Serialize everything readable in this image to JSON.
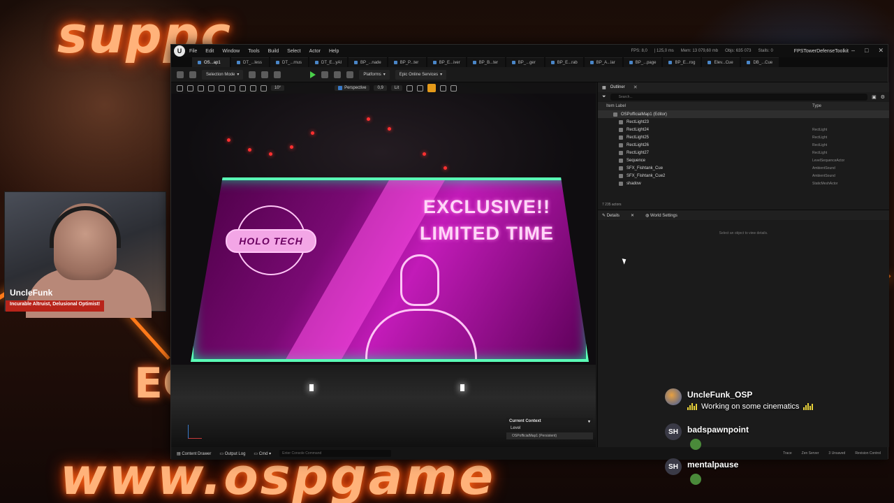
{
  "overlay": {
    "brand_top": "suppc",
    "brand_bottom": "www.ospgame",
    "side_letters": "EC",
    "streamer_name": "UncleFunk",
    "streamer_tagline": "Incurable Altruist, Delusional Optimist!"
  },
  "editor": {
    "menu": [
      "File",
      "Edit",
      "Window",
      "Tools",
      "Build",
      "Select",
      "Actor",
      "Help"
    ],
    "stats": [
      "FPS: 8,0",
      "| 125,0 ms",
      "Mem: 13 079,60 mb",
      "Objs: 635 073",
      "Stalls: 0"
    ],
    "project_title": "FPSTowerDefenseToolkit",
    "tabs": [
      "OS...ap1",
      "DT_...less",
      "DT_...rnus",
      "DT_E...yAI",
      "BP_...nade",
      "BP_P...ter",
      "BP_E...iver",
      "BP_B...ter",
      "BP_...ger",
      "BP_E...rab",
      "BP_A...lar",
      "BP_...page",
      "BP_E...rog",
      "Elev...Cue",
      "DB_...Cue"
    ],
    "toolbar": {
      "selection_mode": "Selection Mode",
      "platforms": "Platforms",
      "online_services": "Epic Online Services"
    },
    "viewport": {
      "perspective": "Perspective",
      "lit": "Lit",
      "speed": "0,9",
      "fov": "10°",
      "context_title": "Current Context",
      "context_level": "Level",
      "context_value": "OSPofficialMap1 (Persistent)"
    },
    "billboard": {
      "logo_text": "HOLO TECH",
      "line1": "EXCLUSIVE!!",
      "line2": "LIMITED TIME"
    },
    "outliner": {
      "tab_label": "Outliner",
      "search_placeholder": "Search...",
      "col_label": "Item Label",
      "col_type": "Type",
      "world_row": "OSPofficialMap1 (Editor)",
      "rows": [
        {
          "label": "RectLight23",
          "type": ""
        },
        {
          "label": "RectLight24",
          "type": "RectLight"
        },
        {
          "label": "RectLight25",
          "type": "RectLight"
        },
        {
          "label": "RectLight26",
          "type": "RectLight"
        },
        {
          "label": "RectLight27",
          "type": "RectLight"
        },
        {
          "label": "Sequence",
          "type": "LevelSequenceActor"
        },
        {
          "label": "SFX_Fishtank_Cue",
          "type": "AmbientSound"
        },
        {
          "label": "SFX_Fishtank_Cue2",
          "type": "AmbientSound"
        },
        {
          "label": "shadow",
          "type": "StaticMeshActor"
        }
      ],
      "actor_count": "7 235 actors"
    },
    "details": {
      "tab_details": "Details",
      "tab_world": "World Settings",
      "hint": "Select an object to view details."
    },
    "statusbar": {
      "content_drawer": "Content Drawer",
      "output_log": "Output Log",
      "cmd": "Cmd",
      "cmd_placeholder": "Enter Console Command",
      "trace": "Trace",
      "zen": "Zen Server",
      "unsaved": "3 Unsaved",
      "revision": "Revision Control"
    }
  },
  "chat": [
    {
      "avatar": "UF",
      "user": "UncleFunk_OSP",
      "text": "Working on some cinematics"
    },
    {
      "avatar": "SH",
      "user": "badspawnpoint",
      "text": ""
    },
    {
      "avatar": "SH",
      "user": "mentalpause",
      "text": ""
    }
  ]
}
